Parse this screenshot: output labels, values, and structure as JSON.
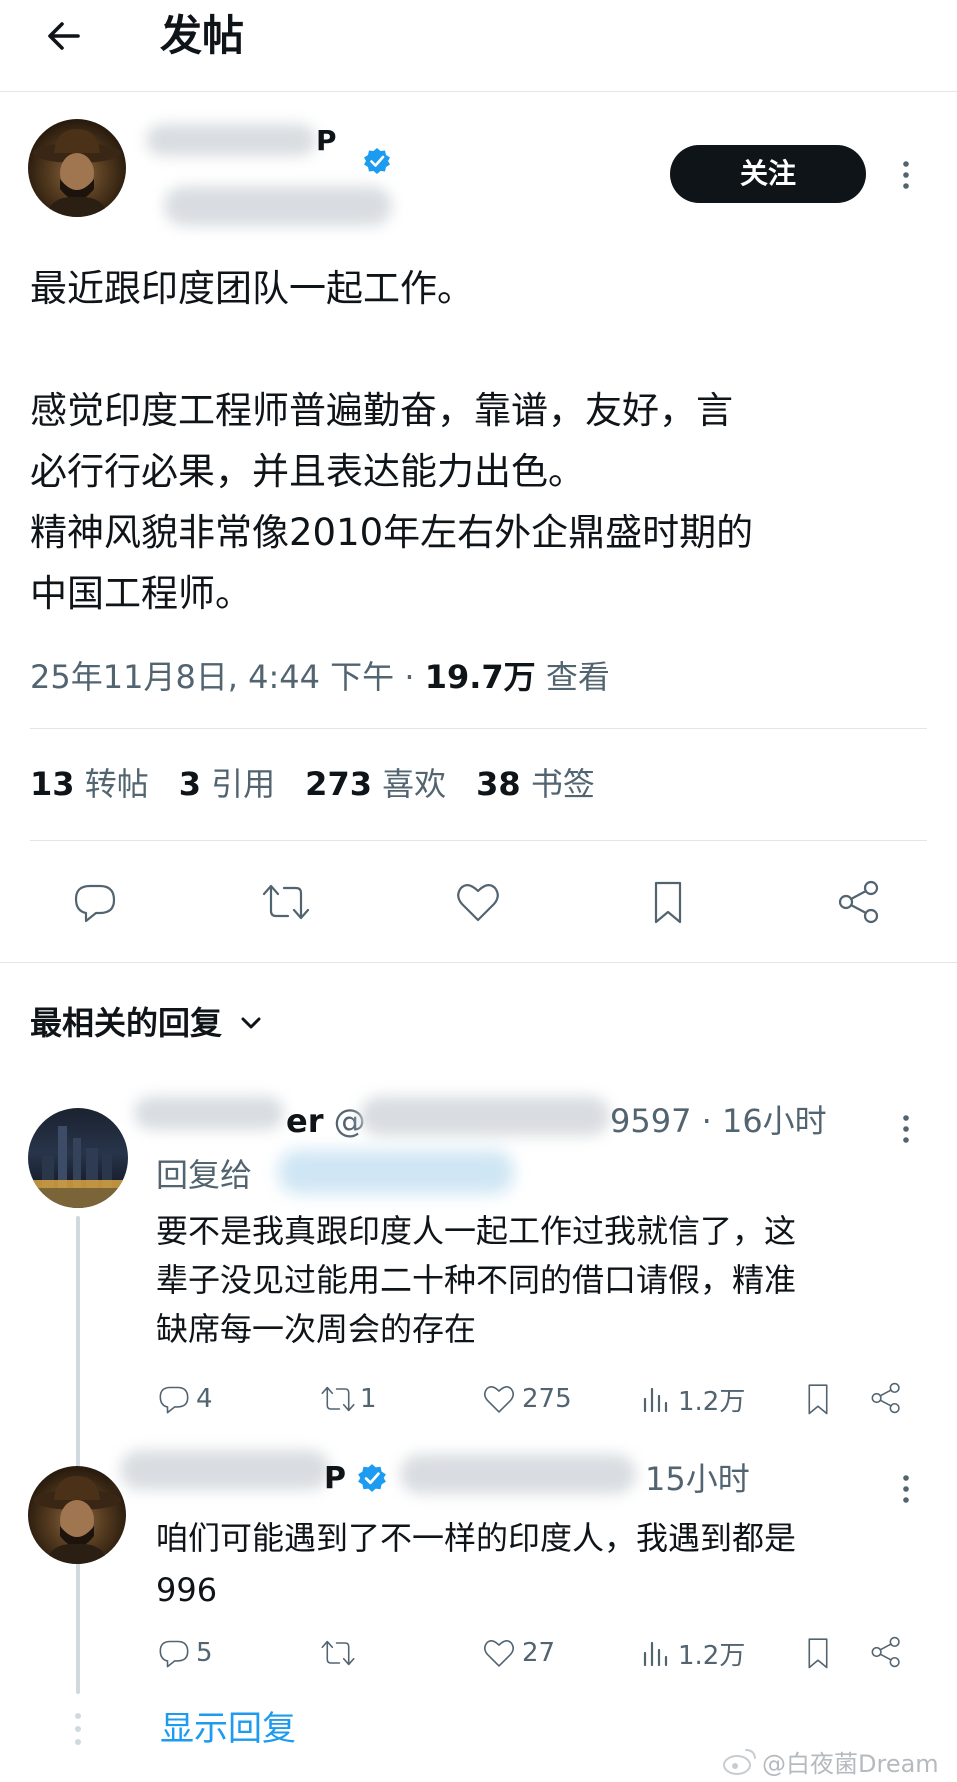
{
  "header": {
    "title": "发帖"
  },
  "tweet": {
    "author_suffix": "P",
    "follow_label": "关注",
    "lines": [
      "最近跟印度团队一起工作。",
      "感觉印度工程师普遍勤奋，靠谱，友好，言",
      "必行行必果，并且表达能力出色。",
      "精神风貌非常像2010年左右外企鼎盛时期的",
      "中国工程师。"
    ],
    "meta": {
      "time": "25年11月8日, 4:44 下午 · ",
      "views": "19.7万",
      "views_label": " 查看"
    },
    "stats": [
      {
        "count": "13",
        "label": "转帖"
      },
      {
        "count": "3",
        "label": "引用"
      },
      {
        "count": "273",
        "label": "喜欢"
      },
      {
        "count": "38",
        "label": "书签"
      }
    ]
  },
  "actions": {
    "icons": [
      "reply-icon",
      "retweet-icon",
      "like-icon",
      "bookmark-icon",
      "share-icon"
    ]
  },
  "replies_header": {
    "label": "最相关的回复"
  },
  "replies": [
    {
      "name_suffix": "er",
      "handle_prefix": "@",
      "handle_suffix": "9597 · 16小时",
      "reply_to_label": "回复给",
      "lines": [
        "要不是我真跟印度人一起工作过我就信了，这",
        "辈子没见过能用二十种不同的借口请假，精准",
        "缺席每一次周会的存在"
      ],
      "stats": {
        "replies": "4",
        "retweets": "1",
        "likes": "275",
        "views": "1.2万"
      }
    },
    {
      "name_suffix": "P",
      "time": "15小时",
      "lines": [
        "咱们可能遇到了不一样的印度人，我遇到都是",
        "996"
      ],
      "stats": {
        "replies": "5",
        "retweets": "",
        "likes": "27",
        "views": "1.2万"
      }
    }
  ],
  "show_replies": {
    "label": "显示回复"
  },
  "watermark": {
    "text": "@白夜菌Dream"
  },
  "colors": {
    "accent": "#1d9bf0",
    "gray": "#536471",
    "text": "#0f1419"
  }
}
